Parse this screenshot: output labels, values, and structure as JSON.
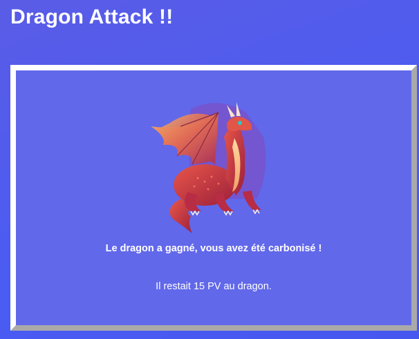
{
  "page": {
    "title": "Dragon Attack !!"
  },
  "game": {
    "dragon_image": "red-dragon-illustration",
    "result_message": "Le dragon a gagné, vous avez été carbonisé !",
    "remaining_hp_text": "Il restait 15 PV au dragon.",
    "dragon_remaining_hp": 15
  },
  "colors": {
    "background": "#4a5cf2",
    "panel": "#6168ea",
    "panel_border_light": "#ffffff",
    "panel_border_dark": "#a9a9a9",
    "text": "#ffffff"
  }
}
